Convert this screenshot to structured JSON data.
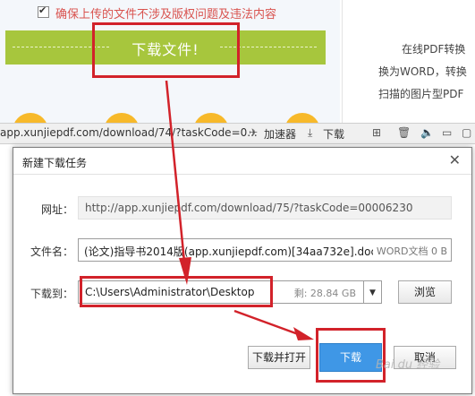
{
  "page": {
    "confirm_text": "确保上传的文件不涉及版权问题及违法内容",
    "download_button": "下载文件!",
    "right_lines": [
      "在线PDF转换",
      "换为WORD，转换",
      "扫描的图片型PDF"
    ]
  },
  "statusbar": {
    "url": "app.xunjiepdf.com/download/74/?taskCode=0...",
    "accelerator": "加速器",
    "download": "下载"
  },
  "dialog": {
    "title": "新建下载任务",
    "url_label": "网址：",
    "url_value": "http://app.xunjiepdf.com/download/75/?taskCode=00006230",
    "filename_label": "文件名：",
    "filename_value": "(论文)指导书2014版(app.xunjiepdf.com)[34aa732e].doc",
    "filename_meta": "WORD文档 0 B",
    "saveto_label": "下载到：",
    "saveto_value": "C:\\Users\\Administrator\\Desktop",
    "free_space": "剩: 28.84 GB",
    "browse": "浏览",
    "download_open": "下载并打开",
    "download": "下载",
    "cancel": "取消"
  },
  "colors": {
    "banner_green": "#a7c63d",
    "highlight_red": "#d2222a",
    "primary_blue": "#3f97e6"
  },
  "watermark": "Bai du 经验"
}
